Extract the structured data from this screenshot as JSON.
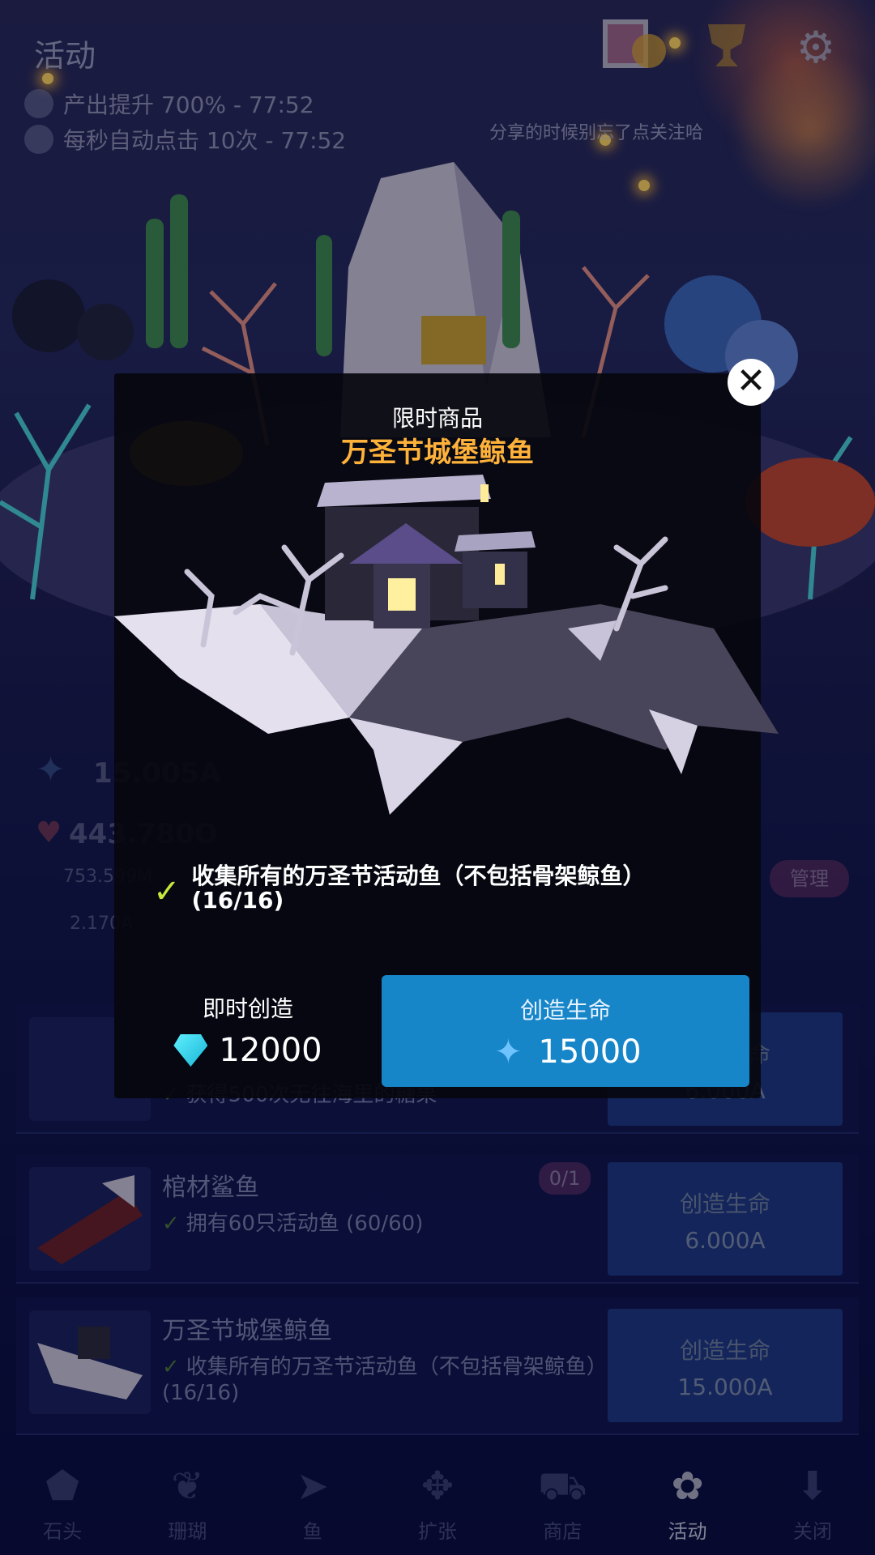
{
  "hud": {
    "title": "活动",
    "boost_output": "产出提升 700% - 77:52",
    "boost_autoclick": "每秒自动点击 10次 - 77:52",
    "share_hint": "分享的时候别忘了点关注哈"
  },
  "background_stats": {
    "candy": "15.005A",
    "heart": "443.780O",
    "tap": "753.599M",
    "plant": "2.170A",
    "manage_button": "管理"
  },
  "list": [
    {
      "name": "",
      "requirement": "获得500次无往海里的糖果",
      "button_title": "创造生命",
      "button_price": "6.000A"
    },
    {
      "name": "棺材鲨鱼",
      "badge": "0/1",
      "requirement": "拥有60只活动鱼 (60/60)",
      "button_title": "创造生命",
      "button_price": "6.000A"
    },
    {
      "name": "万圣节城堡鲸鱼",
      "requirement": "收集所有的万圣节活动鱼（不包括骨架鲸鱼）(16/16)",
      "button_title": "创造生命",
      "button_price": "15.000A"
    }
  ],
  "nav": [
    {
      "label": "石头",
      "icon": "rock-icon"
    },
    {
      "label": "珊瑚",
      "icon": "coral-icon"
    },
    {
      "label": "鱼",
      "icon": "fish-icon"
    },
    {
      "label": "扩张",
      "icon": "expand-icon"
    },
    {
      "label": "商店",
      "icon": "cart-icon"
    },
    {
      "label": "活动",
      "icon": "candy-icon",
      "active": true
    },
    {
      "label": "关闭",
      "icon": "close-down-icon"
    }
  ],
  "modal": {
    "label": "限时商品",
    "title": "万圣节城堡鲸鱼",
    "requirement": "收集所有的万圣节活动鱼（不包括骨架鲸鱼）(16/16)",
    "instant_label": "即时创造",
    "instant_price": "12000",
    "create_label": "创造生命",
    "create_price": "15000"
  },
  "colors": {
    "title_orange": "#ffb23a",
    "button_blue": "#1686c8",
    "check_green": "#c6e83a"
  }
}
